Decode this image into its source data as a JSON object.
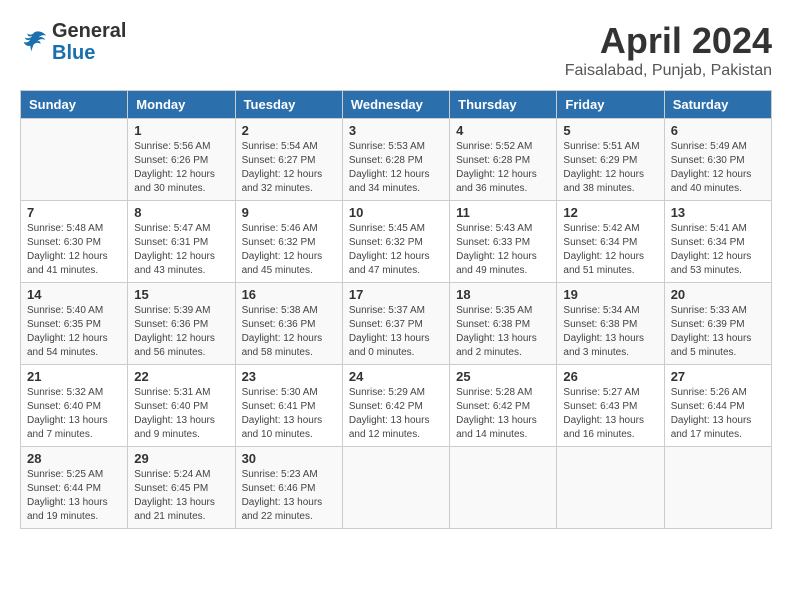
{
  "header": {
    "logo_general": "General",
    "logo_blue": "Blue",
    "title": "April 2024",
    "subtitle": "Faisalabad, Punjab, Pakistan"
  },
  "calendar": {
    "days_of_week": [
      "Sunday",
      "Monday",
      "Tuesday",
      "Wednesday",
      "Thursday",
      "Friday",
      "Saturday"
    ],
    "weeks": [
      [
        {
          "day": "",
          "info": ""
        },
        {
          "day": "1",
          "info": "Sunrise: 5:56 AM\nSunset: 6:26 PM\nDaylight: 12 hours\nand 30 minutes."
        },
        {
          "day": "2",
          "info": "Sunrise: 5:54 AM\nSunset: 6:27 PM\nDaylight: 12 hours\nand 32 minutes."
        },
        {
          "day": "3",
          "info": "Sunrise: 5:53 AM\nSunset: 6:28 PM\nDaylight: 12 hours\nand 34 minutes."
        },
        {
          "day": "4",
          "info": "Sunrise: 5:52 AM\nSunset: 6:28 PM\nDaylight: 12 hours\nand 36 minutes."
        },
        {
          "day": "5",
          "info": "Sunrise: 5:51 AM\nSunset: 6:29 PM\nDaylight: 12 hours\nand 38 minutes."
        },
        {
          "day": "6",
          "info": "Sunrise: 5:49 AM\nSunset: 6:30 PM\nDaylight: 12 hours\nand 40 minutes."
        }
      ],
      [
        {
          "day": "7",
          "info": "Sunrise: 5:48 AM\nSunset: 6:30 PM\nDaylight: 12 hours\nand 41 minutes."
        },
        {
          "day": "8",
          "info": "Sunrise: 5:47 AM\nSunset: 6:31 PM\nDaylight: 12 hours\nand 43 minutes."
        },
        {
          "day": "9",
          "info": "Sunrise: 5:46 AM\nSunset: 6:32 PM\nDaylight: 12 hours\nand 45 minutes."
        },
        {
          "day": "10",
          "info": "Sunrise: 5:45 AM\nSunset: 6:32 PM\nDaylight: 12 hours\nand 47 minutes."
        },
        {
          "day": "11",
          "info": "Sunrise: 5:43 AM\nSunset: 6:33 PM\nDaylight: 12 hours\nand 49 minutes."
        },
        {
          "day": "12",
          "info": "Sunrise: 5:42 AM\nSunset: 6:34 PM\nDaylight: 12 hours\nand 51 minutes."
        },
        {
          "day": "13",
          "info": "Sunrise: 5:41 AM\nSunset: 6:34 PM\nDaylight: 12 hours\nand 53 minutes."
        }
      ],
      [
        {
          "day": "14",
          "info": "Sunrise: 5:40 AM\nSunset: 6:35 PM\nDaylight: 12 hours\nand 54 minutes."
        },
        {
          "day": "15",
          "info": "Sunrise: 5:39 AM\nSunset: 6:36 PM\nDaylight: 12 hours\nand 56 minutes."
        },
        {
          "day": "16",
          "info": "Sunrise: 5:38 AM\nSunset: 6:36 PM\nDaylight: 12 hours\nand 58 minutes."
        },
        {
          "day": "17",
          "info": "Sunrise: 5:37 AM\nSunset: 6:37 PM\nDaylight: 13 hours\nand 0 minutes."
        },
        {
          "day": "18",
          "info": "Sunrise: 5:35 AM\nSunset: 6:38 PM\nDaylight: 13 hours\nand 2 minutes."
        },
        {
          "day": "19",
          "info": "Sunrise: 5:34 AM\nSunset: 6:38 PM\nDaylight: 13 hours\nand 3 minutes."
        },
        {
          "day": "20",
          "info": "Sunrise: 5:33 AM\nSunset: 6:39 PM\nDaylight: 13 hours\nand 5 minutes."
        }
      ],
      [
        {
          "day": "21",
          "info": "Sunrise: 5:32 AM\nSunset: 6:40 PM\nDaylight: 13 hours\nand 7 minutes."
        },
        {
          "day": "22",
          "info": "Sunrise: 5:31 AM\nSunset: 6:40 PM\nDaylight: 13 hours\nand 9 minutes."
        },
        {
          "day": "23",
          "info": "Sunrise: 5:30 AM\nSunset: 6:41 PM\nDaylight: 13 hours\nand 10 minutes."
        },
        {
          "day": "24",
          "info": "Sunrise: 5:29 AM\nSunset: 6:42 PM\nDaylight: 13 hours\nand 12 minutes."
        },
        {
          "day": "25",
          "info": "Sunrise: 5:28 AM\nSunset: 6:42 PM\nDaylight: 13 hours\nand 14 minutes."
        },
        {
          "day": "26",
          "info": "Sunrise: 5:27 AM\nSunset: 6:43 PM\nDaylight: 13 hours\nand 16 minutes."
        },
        {
          "day": "27",
          "info": "Sunrise: 5:26 AM\nSunset: 6:44 PM\nDaylight: 13 hours\nand 17 minutes."
        }
      ],
      [
        {
          "day": "28",
          "info": "Sunrise: 5:25 AM\nSunset: 6:44 PM\nDaylight: 13 hours\nand 19 minutes."
        },
        {
          "day": "29",
          "info": "Sunrise: 5:24 AM\nSunset: 6:45 PM\nDaylight: 13 hours\nand 21 minutes."
        },
        {
          "day": "30",
          "info": "Sunrise: 5:23 AM\nSunset: 6:46 PM\nDaylight: 13 hours\nand 22 minutes."
        },
        {
          "day": "",
          "info": ""
        },
        {
          "day": "",
          "info": ""
        },
        {
          "day": "",
          "info": ""
        },
        {
          "day": "",
          "info": ""
        }
      ]
    ]
  }
}
